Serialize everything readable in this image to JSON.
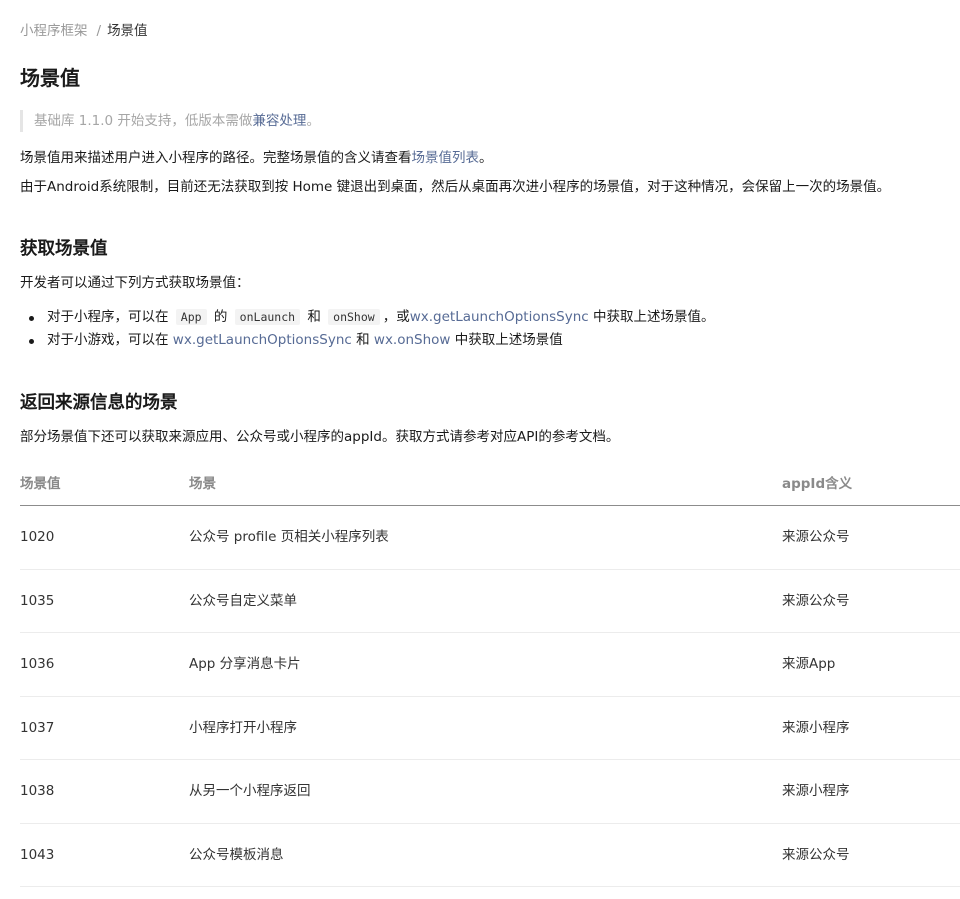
{
  "breadcrumb": {
    "parent": "小程序框架",
    "separator": "/",
    "current": "场景值"
  },
  "page_title": "场景值",
  "tip": {
    "prefix": "基础库 1.1.0 开始支持，低版本需做",
    "link": "兼容处理",
    "suffix": "。"
  },
  "intro": {
    "line1_prefix": "场景值用来描述用户进入小程序的路径。完整场景值的含义请查看",
    "line1_link": "场景值列表",
    "line1_suffix": "。",
    "line2": "由于Android系统限制，目前还无法获取到按 Home 键退出到桌面，然后从桌面再次进小程序的场景值，对于这种情况，会保留上一次的场景值。"
  },
  "section_get": {
    "title": "获取场景值",
    "desc": "开发者可以通过下列方式获取场景值：",
    "bullet1": {
      "prefix": "对于小程序，可以在",
      "code1": "App",
      "mid1": "的",
      "code2": "onLaunch",
      "mid2": "和",
      "code3": "onShow",
      "mid3": "，或",
      "link": "wx.getLaunchOptionsSync",
      "suffix": "中获取上述场景值。"
    },
    "bullet2": {
      "prefix": "对于小游戏，可以在",
      "link1": "wx.getLaunchOptionsSync",
      "mid": "和",
      "link2": "wx.onShow",
      "suffix": "中获取上述场景值"
    }
  },
  "section_source": {
    "title": "返回来源信息的场景",
    "desc": "部分场景值下还可以获取来源应用、公众号或小程序的appId。获取方式请参考对应API的参考文档。"
  },
  "table": {
    "headers": [
      "场景值",
      "场景",
      "appId含义"
    ],
    "rows": [
      [
        "1020",
        "公众号 profile 页相关小程序列表",
        "来源公众号"
      ],
      [
        "1035",
        "公众号自定义菜单",
        "来源公众号"
      ],
      [
        "1036",
        "App 分享消息卡片",
        "来源App"
      ],
      [
        "1037",
        "小程序打开小程序",
        "来源小程序"
      ],
      [
        "1038",
        "从另一个小程序返回",
        "来源小程序"
      ],
      [
        "1043",
        "公众号模板消息",
        "来源公众号"
      ]
    ]
  },
  "colors": {
    "link": "#576b95",
    "muted": "#9a9a9a",
    "text": "#1a1a1a"
  }
}
